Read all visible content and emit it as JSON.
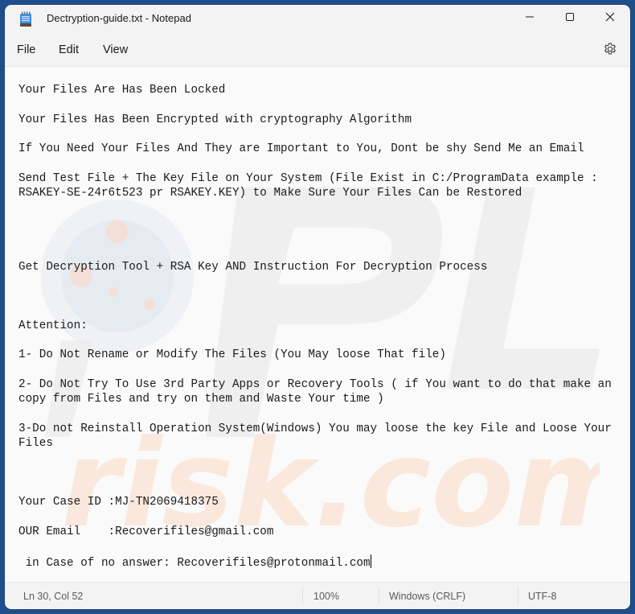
{
  "window": {
    "title": "Dectryption-guide.txt - Notepad",
    "app_icon": "notepad-icon",
    "controls": {
      "minimize": "minimize-icon",
      "maximize": "maximize-icon",
      "close": "close-icon"
    }
  },
  "menu": {
    "items": [
      "File",
      "Edit",
      "View"
    ],
    "settings_icon": "gear-icon"
  },
  "editor": {
    "lines": [
      "Your Files Are Has Been Locked",
      "",
      "Your Files Has Been Encrypted with cryptography Algorithm",
      "",
      "If You Need Your Files And They are Important to You, Dont be shy Send Me an Email",
      "",
      "Send Test File + The Key File on Your System (File Exist in C:/ProgramData example :",
      "RSAKEY-SE-24r6t523 pr RSAKEY.KEY) to Make Sure Your Files Can be Restored",
      "",
      "",
      "",
      "",
      "Get Decryption Tool + RSA Key AND Instruction For Decryption Process",
      "",
      "",
      "",
      "Attention:",
      "",
      "1- Do Not Rename or Modify The Files (You May loose That file)",
      "",
      "2- Do Not Try To Use 3rd Party Apps or Recovery Tools ( if You want to do that make an",
      "copy from Files and try on them and Waste Your time )",
      "",
      "3-Do not Reinstall Operation System(Windows) You may loose the key File and Loose Your",
      "Files",
      "",
      "",
      "",
      "Your Case ID :MJ-TN2069418375",
      "",
      "OUR Email    :Recoverifiles@gmail.com",
      "",
      " in Case of no answer: Recoverifiles@protonmail.com"
    ],
    "watermark": "PCrisk.com"
  },
  "status": {
    "position": "Ln 30, Col 52",
    "zoom": "100%",
    "line_ending": "Windows (CRLF)",
    "encoding": "UTF-8"
  }
}
